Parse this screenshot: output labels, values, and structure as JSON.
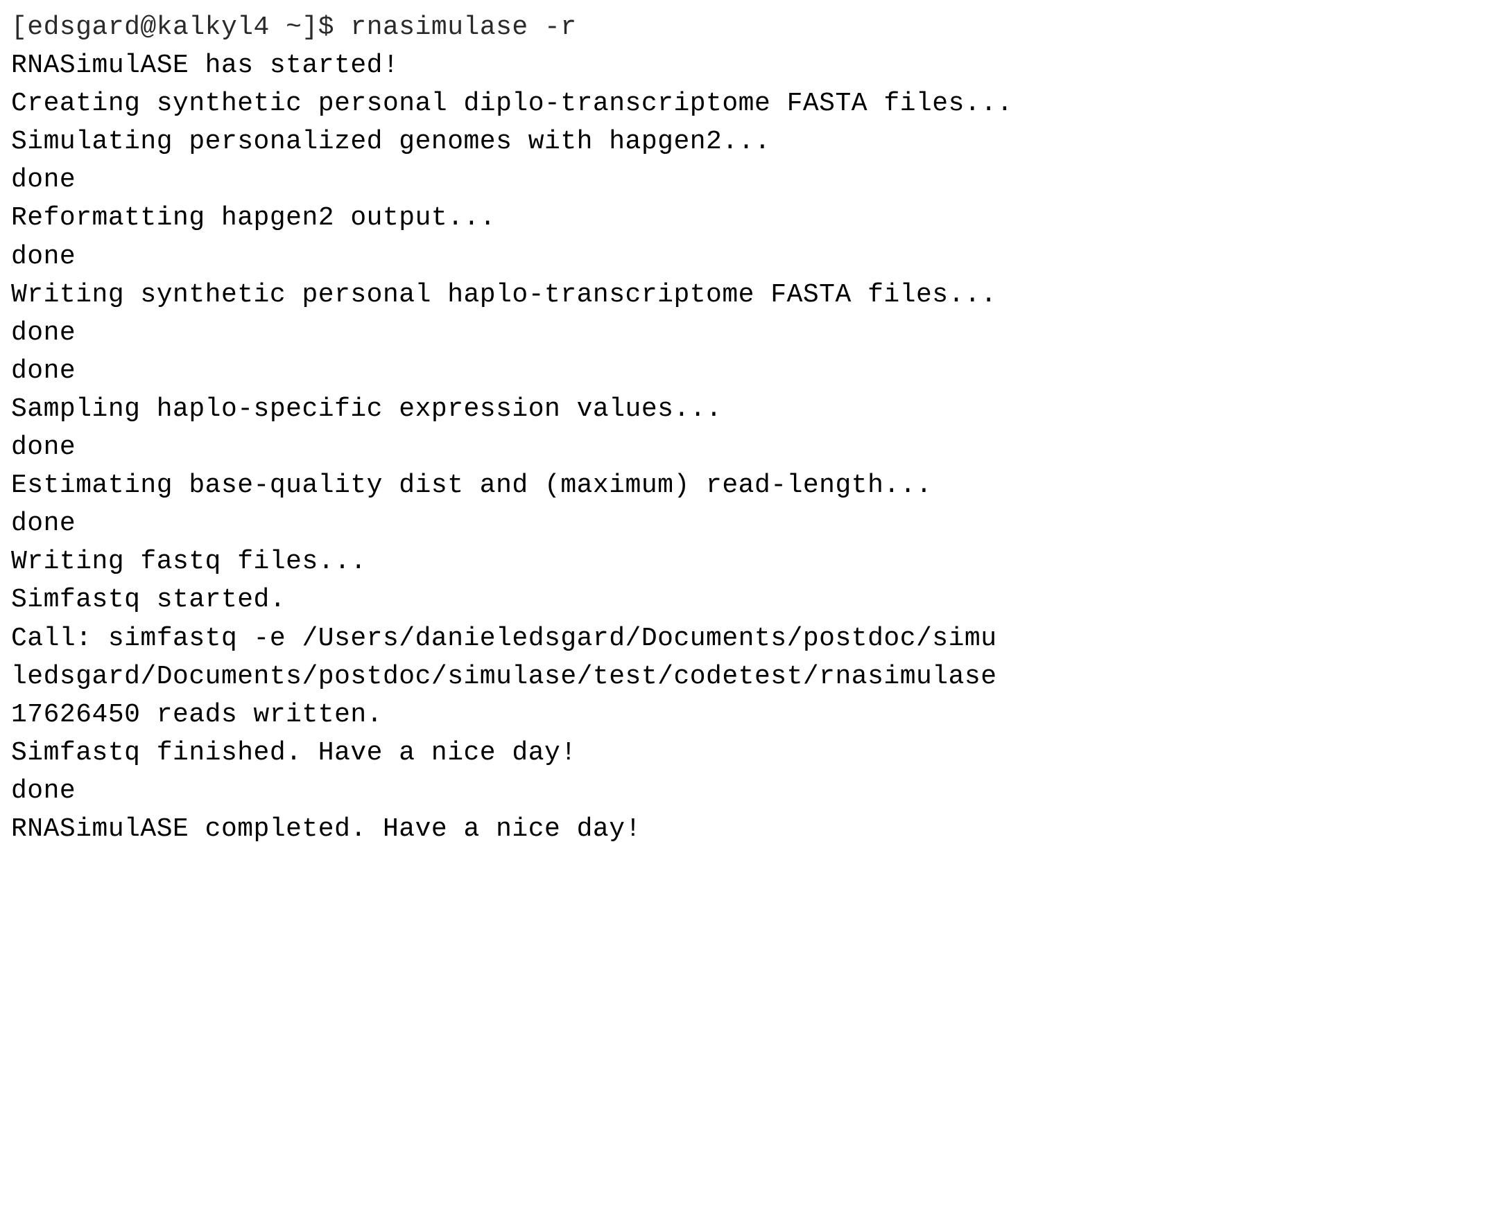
{
  "terminal": {
    "prompt": "[edsgard@kalkyl4 ~]$ ",
    "command": "rnasimulase -r",
    "lines": [
      "RNASimulASE has started!",
      "Creating synthetic personal diplo-transcriptome FASTA files...",
      "Simulating personalized genomes with hapgen2...",
      "done",
      "Reformatting hapgen2 output...",
      "done",
      "Writing synthetic personal haplo-transcriptome FASTA files...",
      "done",
      "done",
      "Sampling haplo-specific expression values...",
      "done",
      "Estimating base-quality dist and (maximum) read-length...",
      "done",
      "Writing fastq files...",
      "Simfastq started.",
      "Call: simfastq -e /Users/danieledsgard/Documents/postdoc/simu",
      "ledsgard/Documents/postdoc/simulase/test/codetest/rnasimulase",
      "17626450 reads written.",
      "Simfastq finished. Have a nice day!",
      "done",
      "RNASimulASE completed. Have a nice day!"
    ]
  }
}
